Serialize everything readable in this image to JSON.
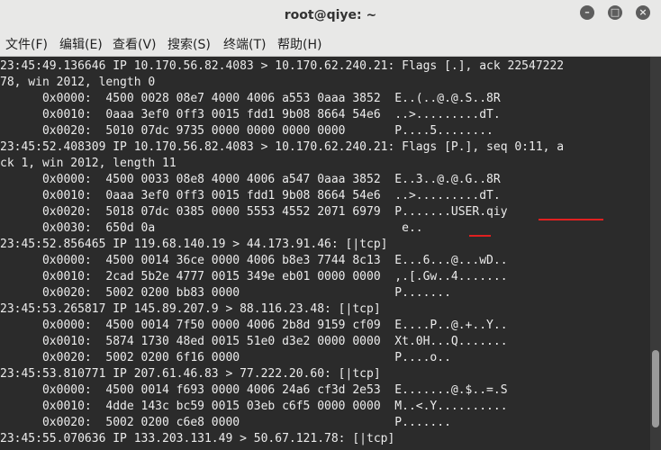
{
  "window": {
    "title": "root@qiye: ~"
  },
  "controls": {
    "minimize": "–",
    "maximize": "□",
    "close": "×"
  },
  "menu": [
    "文件(F)",
    "编辑(E)",
    "查看(V)",
    "搜索(S)",
    "终端(T)",
    "帮助(H)"
  ],
  "terminal_lines": [
    "23:45:49.136646 IP 10.170.56.82.4083 > 10.170.62.240.21: Flags [.], ack 22547222",
    "78, win 2012, length 0",
    "      0x0000:  4500 0028 08e7 4000 4006 a553 0aaa 3852  E..(..@.@.S..8R",
    "      0x0010:  0aaa 3ef0 0ff3 0015 fdd1 9b08 8664 54e6  ..>.........dT.",
    "      0x0020:  5010 07dc 9735 0000 0000 0000 0000       P....5........",
    "23:45:52.408309 IP 10.170.56.82.4083 > 10.170.62.240.21: Flags [P.], seq 0:11, a",
    "ck 1, win 2012, length 11",
    "      0x0000:  4500 0033 08e8 4000 4006 a547 0aaa 3852  E..3..@.@.G..8R",
    "      0x0010:  0aaa 3ef0 0ff3 0015 fdd1 9b08 8664 54e6  ..>.........dT.",
    "      0x0020:  5018 07dc 0385 0000 5553 4552 2071 6979  P.......USER.qiy",
    "      0x0030:  650d 0a                                   e..",
    "23:45:52.856465 IP 119.68.140.19 > 44.173.91.46: [|tcp]",
    "      0x0000:  4500 0014 36ce 0000 4006 b8e3 7744 8c13  E...6...@...wD..",
    "      0x0010:  2cad 5b2e 4777 0015 349e eb01 0000 0000  ,.[.Gw..4.......",
    "      0x0020:  5002 0200 bb83 0000                      P.......",
    "23:45:53.265817 IP 145.89.207.9 > 88.116.23.48: [|tcp]",
    "      0x0000:  4500 0014 7f50 0000 4006 2b8d 9159 cf09  E....P..@.+..Y..",
    "      0x0010:  5874 1730 48ed 0015 51e0 d3e2 0000 0000  Xt.0H...Q.......",
    "      0x0020:  5002 0200 6f16 0000                      P....o..",
    "23:45:53.810771 IP 207.61.46.83 > 77.222.20.60: [|tcp]",
    "      0x0000:  4500 0014 f693 0000 4006 24a6 cf3d 2e53  E.......@.$..=.S",
    "      0x0010:  4dde 143c bc59 0015 03eb c6f5 0000 0000  M..<.Y..........",
    "      0x0020:  5002 0200 c6e8 0000                      P.......",
    "23:45:55.070636 IP 133.203.131.49 > 50.67.121.78: [|tcp]"
  ]
}
